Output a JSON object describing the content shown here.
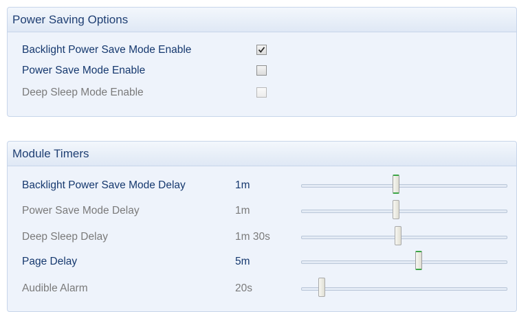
{
  "power_saving": {
    "title": "Power Saving Options",
    "options": [
      {
        "label": "Backlight Power Save Mode Enable",
        "checked": true,
        "enabled": true
      },
      {
        "label": "Power Save Mode Enable",
        "checked": false,
        "enabled": true
      },
      {
        "label": "Deep Sleep Mode Enable",
        "checked": false,
        "enabled": false
      }
    ]
  },
  "module_timers": {
    "title": "Module Timers",
    "timers": [
      {
        "label": "Backlight Power Save Mode Delay",
        "value": "1m",
        "enabled": true,
        "slider_fraction": 0.46,
        "focused": true
      },
      {
        "label": "Power Save Mode Delay",
        "value": "1m",
        "enabled": false,
        "slider_fraction": 0.46,
        "focused": false
      },
      {
        "label": "Deep Sleep Delay",
        "value": "1m 30s",
        "enabled": false,
        "slider_fraction": 0.47,
        "focused": false
      },
      {
        "label": "Page Delay",
        "value": "5m",
        "enabled": true,
        "slider_fraction": 0.57,
        "focused": true
      },
      {
        "label": "Audible Alarm",
        "value": "20s",
        "enabled": false,
        "slider_fraction": 0.1,
        "focused": false
      }
    ]
  },
  "colors": {
    "enabled_text": "#15386e",
    "disabled_text": "#7a7a7a",
    "panel_background": "#eef3fb",
    "slider_focus_accent": "#3aa545"
  }
}
